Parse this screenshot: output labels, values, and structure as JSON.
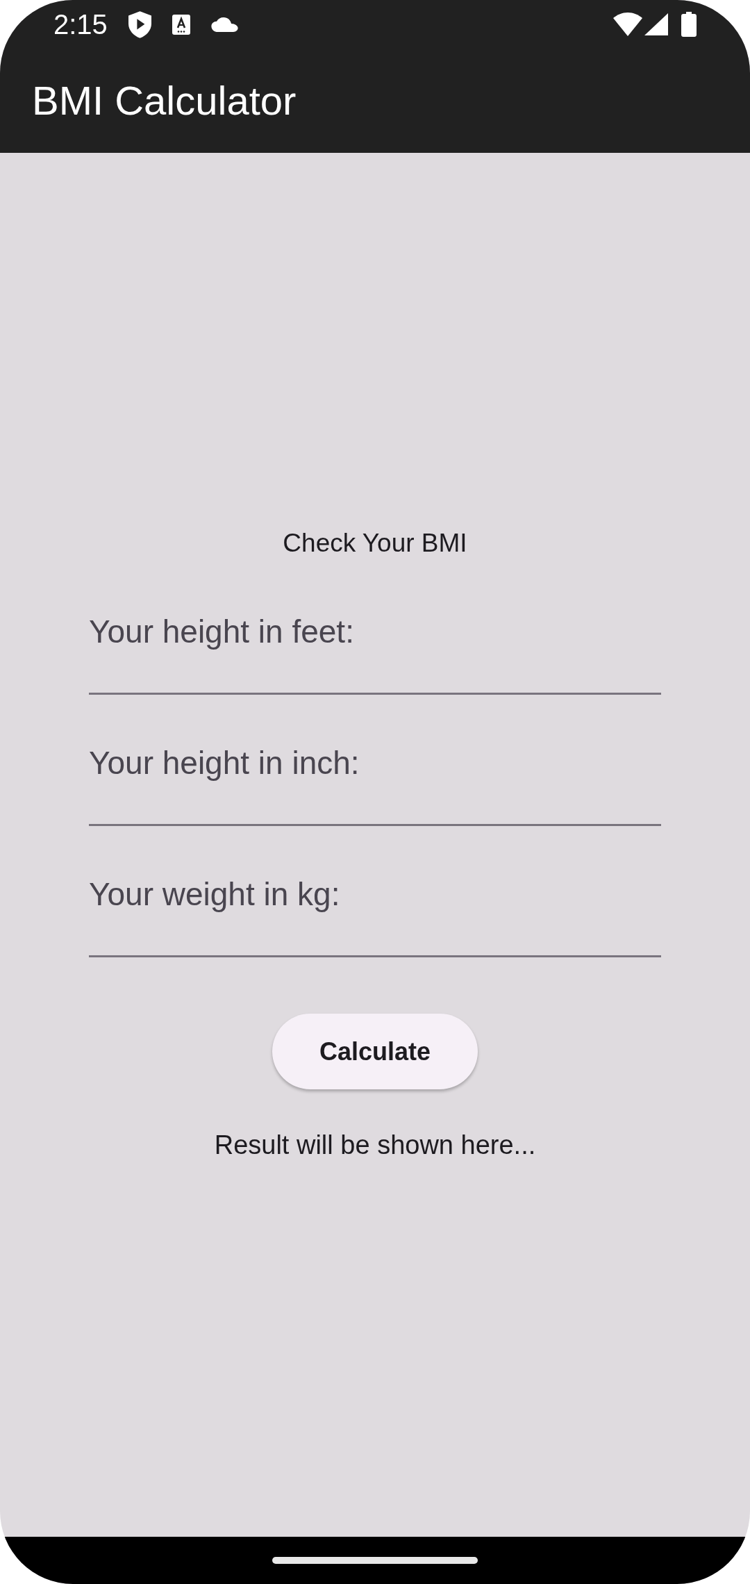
{
  "status_bar": {
    "time": "2:15"
  },
  "app_bar": {
    "title": "BMI Calculator"
  },
  "form": {
    "heading": "Check Your BMI",
    "fields": [
      {
        "placeholder": "Your height in feet:"
      },
      {
        "placeholder": "Your height in inch:"
      },
      {
        "placeholder": "Your weight in kg:"
      }
    ],
    "button": "Calculate",
    "result": "Result will be shown here..."
  }
}
